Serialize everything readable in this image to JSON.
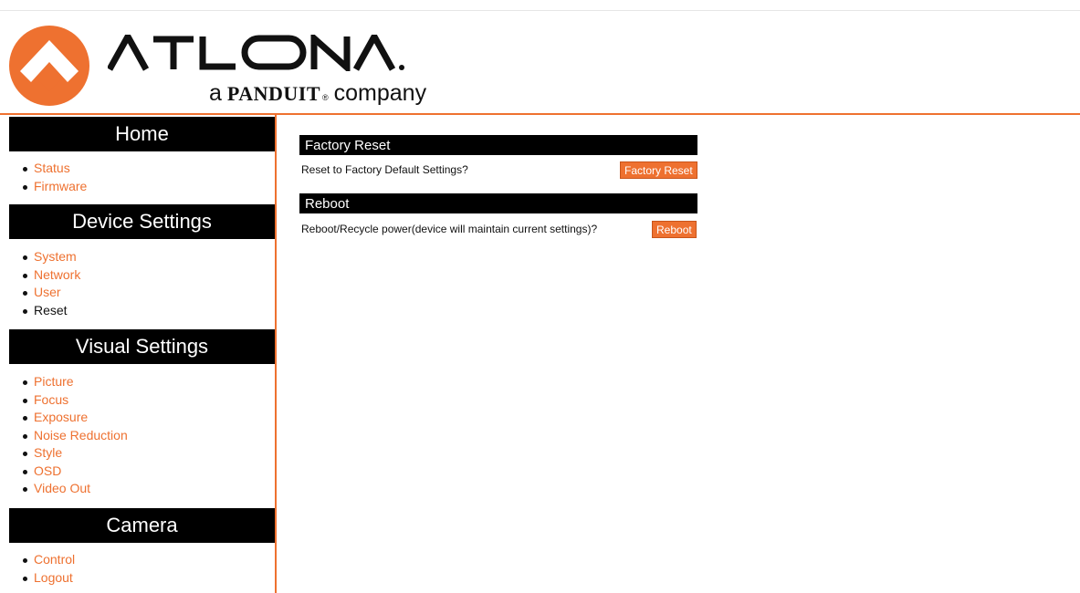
{
  "branding": {
    "name": "ATLONA",
    "tagline_prefix": "a",
    "tagline_brand": "PANDUIT",
    "tagline_trademark": "®",
    "tagline_suffix": "company",
    "logo_icon": "atlona-logo-icon"
  },
  "colors": {
    "accent": "#ee7130",
    "bar": "#000000",
    "text": "#111111"
  },
  "sidebar": {
    "sections": [
      {
        "title": "Home",
        "items": [
          {
            "label": "Status",
            "current": false
          },
          {
            "label": "Firmware",
            "current": false
          }
        ]
      },
      {
        "title": "Device Settings",
        "items": [
          {
            "label": "System",
            "current": false
          },
          {
            "label": "Network",
            "current": false
          },
          {
            "label": "User",
            "current": false
          },
          {
            "label": "Reset",
            "current": true
          }
        ]
      },
      {
        "title": "Visual Settings",
        "items": [
          {
            "label": "Picture",
            "current": false
          },
          {
            "label": "Focus",
            "current": false
          },
          {
            "label": "Exposure",
            "current": false
          },
          {
            "label": "Noise Reduction",
            "current": false
          },
          {
            "label": "Style",
            "current": false
          },
          {
            "label": "OSD",
            "current": false
          },
          {
            "label": "Video Out",
            "current": false
          }
        ]
      },
      {
        "title": "Camera",
        "items": [
          {
            "label": "Control",
            "current": false
          },
          {
            "label": "Logout",
            "current": false
          }
        ]
      }
    ]
  },
  "main": {
    "factory_reset": {
      "title": "Factory Reset",
      "prompt": "Reset to Factory Default Settings?",
      "button_label": "Factory Reset"
    },
    "reboot": {
      "title": "Reboot",
      "prompt": "Reboot/Recycle power(device will maintain current settings)?",
      "button_label": "Reboot"
    }
  }
}
